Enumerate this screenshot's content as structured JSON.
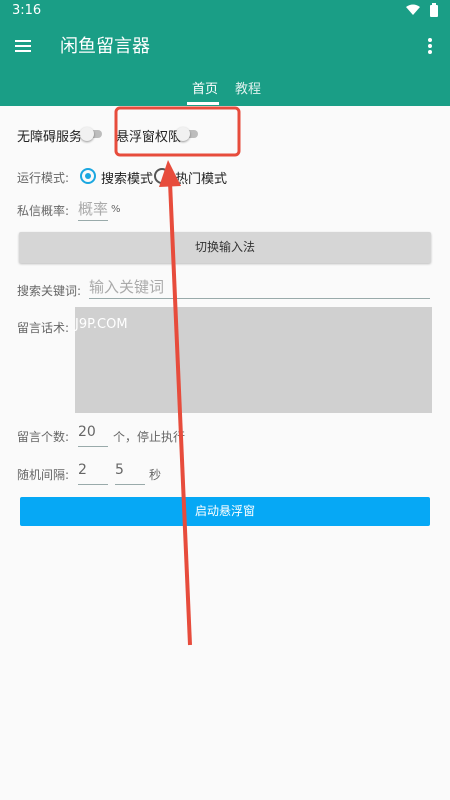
{
  "status_bar": {
    "time": "3:16",
    "icons": [
      "wifi-icon",
      "battery-icon"
    ]
  },
  "app_bar": {
    "title": "闲鱼留言器",
    "menu_icon": "menu-icon",
    "more_icon": "more-vert-icon"
  },
  "tabs": [
    {
      "label": "首页",
      "selected": true
    },
    {
      "label": "教程",
      "selected": false
    }
  ],
  "permissions": {
    "accessibility_label": "无障碍服务",
    "accessibility_on": false,
    "float_window_label": "悬浮窗权限",
    "float_window_on": false
  },
  "run_mode": {
    "label": "运行模式:",
    "options": [
      {
        "label": "搜索模式",
        "selected": true
      },
      {
        "label": "热门模式",
        "selected": false
      }
    ]
  },
  "private_msg": {
    "label": "私信概率:",
    "placeholder": "概率",
    "unit": "%"
  },
  "switch_ime_button": "切换输入法",
  "search_keyword": {
    "label": "搜索关键词:",
    "placeholder": "输入关键词"
  },
  "message_script": {
    "label": "留言话术:",
    "watermark": "J9P.COM"
  },
  "message_count": {
    "label": "留言个数:",
    "value": "20",
    "suffix": "个，停止执行"
  },
  "interval": {
    "label": "随机间隔:",
    "min": "2",
    "max": "5",
    "unit": "秒"
  },
  "start_button": "启动悬浮窗",
  "colors": {
    "primary": "#1a9e86",
    "accent": "#1ba7e0",
    "start_button": "#06a8f5",
    "annotation": "#e74c3c"
  }
}
